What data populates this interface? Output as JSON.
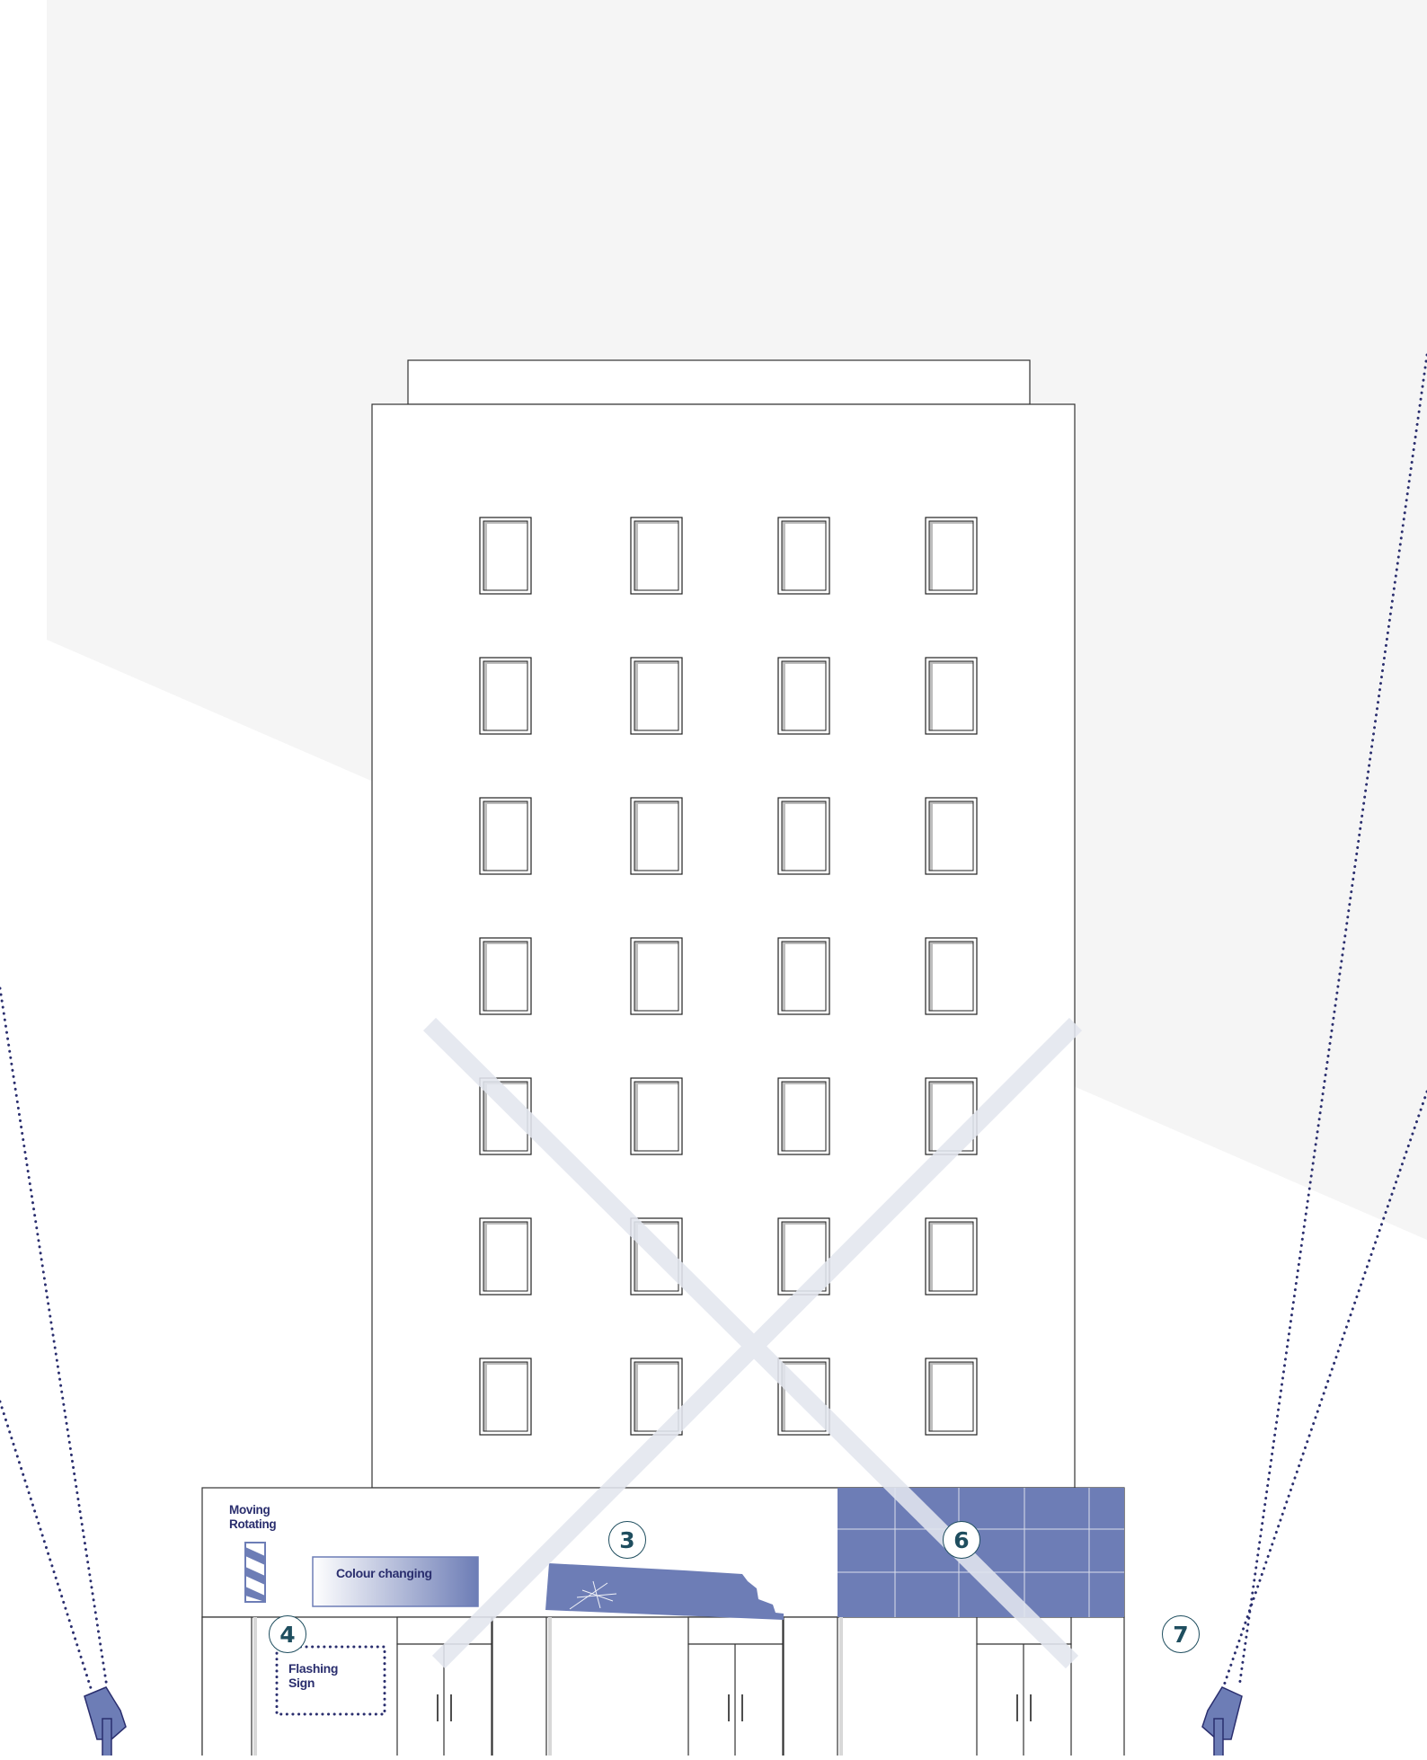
{
  "labels": {
    "moving_rotating": "Moving\nRotating",
    "colour_changing": "Colour changing",
    "flashing_sign": "Flashing\nSign"
  },
  "markers": {
    "m3": "3",
    "m4": "4",
    "m6": "6",
    "m7": "7"
  },
  "colors": {
    "sign_blue": "#6d7db6",
    "ink": "#2a2e6e",
    "badge_teal": "#1f4e5f",
    "sky_grey": "#f5f5f5",
    "cross_overlay": "#e3e6ef",
    "window_shadow": "#bdbdbd"
  }
}
